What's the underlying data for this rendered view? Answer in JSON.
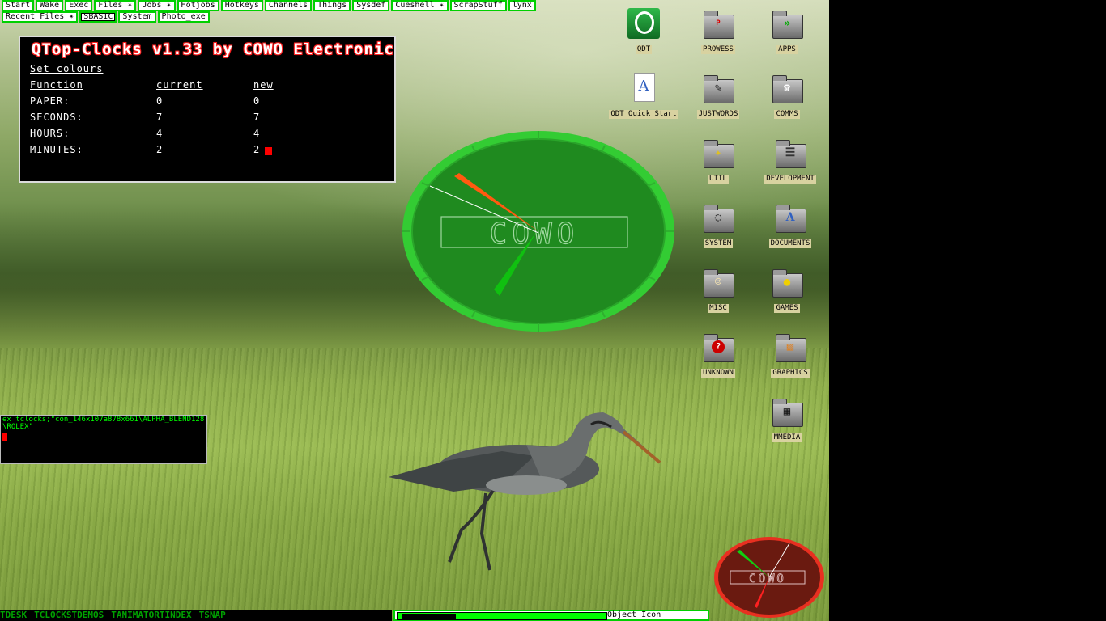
{
  "menu": {
    "row1": [
      "Start",
      "Wake",
      "Exec",
      "Files ✴",
      "Jobs ✴",
      "Hotjobs",
      "Hotkeys",
      "Channels",
      "Things",
      "Sysdef",
      "Cueshell ✴",
      "ScrapStuff",
      "lynx"
    ],
    "row2": [
      "Recent Files ✴",
      "SBASIC",
      "System",
      "Photo_exe"
    ]
  },
  "config_window": {
    "title": "QTop-Clocks v1.33 by COWO Electronic",
    "subtitle": "Set colours",
    "headers": [
      "Function",
      "current",
      "new"
    ],
    "rows": [
      {
        "function": "PAPER:",
        "current": "0",
        "new": "0"
      },
      {
        "function": "SECONDS:",
        "current": "7",
        "new": "7"
      },
      {
        "function": "HOURS:",
        "current": "4",
        "new": "4"
      },
      {
        "function": "MINUTES:",
        "current": "2",
        "new": "2"
      }
    ]
  },
  "command_window": {
    "text": "ex tclocks;\"con_146x107a878x661\\ALPHA_BLEND128\\ROLEX\""
  },
  "clock_logo": "COWO",
  "icons": [
    {
      "id": "qdt",
      "label": "QDT",
      "icon": "qdt-logo-icon"
    },
    {
      "id": "prowess",
      "label": "PROWESS",
      "icon": "folder-icon"
    },
    {
      "id": "apps",
      "label": "APPS",
      "icon": "folder-icon"
    },
    {
      "id": "qdt_quick_start",
      "label": "QDT Quick Start",
      "icon": "document-icon"
    },
    {
      "id": "justwords",
      "label": "JUSTWORDS",
      "icon": "folder-icon"
    },
    {
      "id": "comms",
      "label": "COMMS",
      "icon": "folder-icon"
    },
    {
      "id": "util",
      "label": "UTIL",
      "icon": "folder-icon"
    },
    {
      "id": "development",
      "label": "DEVELOPMENT",
      "icon": "folder-icon"
    },
    {
      "id": "system",
      "label": "SYSTEM",
      "icon": "folder-icon"
    },
    {
      "id": "documents",
      "label": "DOCUMENTS",
      "icon": "folder-icon"
    },
    {
      "id": "misc",
      "label": "MISC",
      "icon": "folder-icon"
    },
    {
      "id": "games",
      "label": "GAMES",
      "icon": "folder-icon"
    },
    {
      "id": "unknown",
      "label": "UNKNOWN",
      "icon": "folder-icon"
    },
    {
      "id": "graphics",
      "label": "GRAPHICS",
      "icon": "folder-icon"
    },
    {
      "id": "mmedia",
      "label": "MMEDIA",
      "icon": "folder-icon"
    }
  ],
  "taskbar": {
    "items": [
      "TDESK",
      "TCLOCKS",
      "TDEMOS",
      "TANIMATOR",
      "TINDEX",
      "TSNAP"
    ],
    "status_text": "Object Icon"
  },
  "colors": {
    "menu_border": "#00d000",
    "taskbar_text": "#00a000",
    "cursor": "#ff0000",
    "clock_face": "#1f8a1f",
    "small_clock_face": "#6a1a10"
  }
}
